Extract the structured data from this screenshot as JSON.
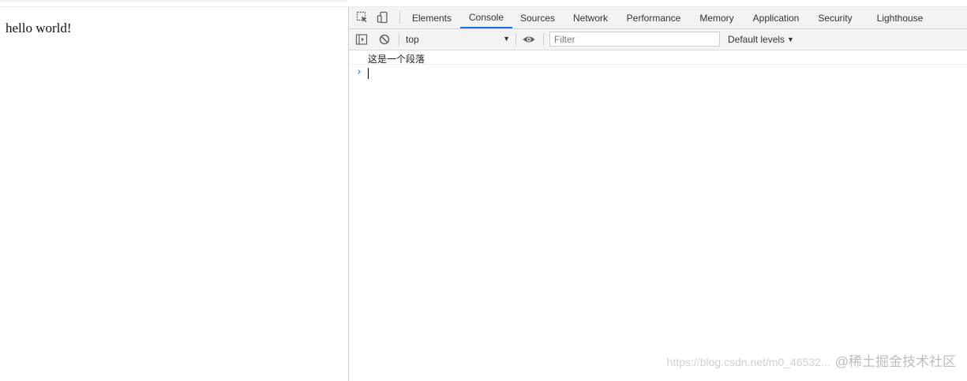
{
  "page": {
    "text": "hello world!"
  },
  "devtools": {
    "tabs": [
      {
        "label": "Elements",
        "active": false
      },
      {
        "label": "Console",
        "active": true
      },
      {
        "label": "Sources",
        "active": false
      },
      {
        "label": "Network",
        "active": false
      },
      {
        "label": "Performance",
        "active": false
      },
      {
        "label": "Memory",
        "active": false
      },
      {
        "label": "Application",
        "active": false
      },
      {
        "label": "Security",
        "active": false
      },
      {
        "label": "Lighthouse",
        "active": false
      }
    ],
    "icons": {
      "inspect": "inspect-element-icon",
      "device": "device-toolbar-icon",
      "sidebar": "show-sidebar-icon",
      "clear": "clear-console-icon",
      "eye": "live-expression-icon"
    },
    "toolbar": {
      "context": "top",
      "filter_placeholder": "Filter",
      "levels": "Default levels"
    },
    "console": {
      "log": "这是一个段落",
      "prompt": "›"
    },
    "accent": "#1a73e8"
  },
  "watermark": {
    "url": "https://blog.csdn.net/m0_46532...",
    "brand": "@稀土掘金技术社区"
  }
}
